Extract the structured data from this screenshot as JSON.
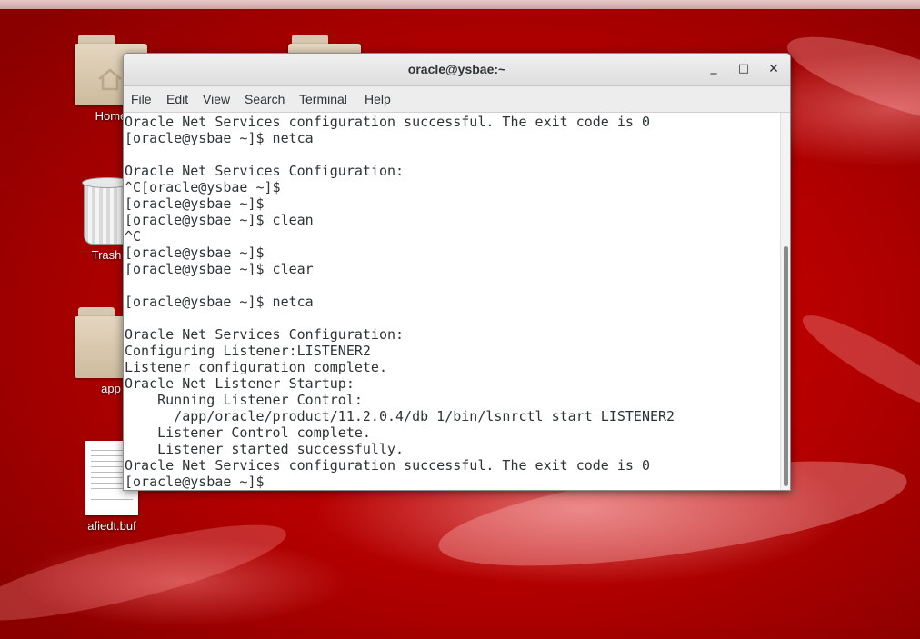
{
  "desktop": {
    "icons": [
      {
        "label": "Home",
        "icon": "home-folder-icon"
      },
      {
        "label": "",
        "icon": "folder-icon"
      },
      {
        "label": "Trash",
        "icon": "trash-icon"
      },
      {
        "label": "app",
        "icon": "folder-icon"
      },
      {
        "label": "afiedt.buf",
        "icon": "text-document-icon"
      }
    ],
    "accent_color": "#cc0000"
  },
  "terminal": {
    "title": "oracle@ysbae:~",
    "controls": {
      "minimize": "_",
      "maximize": "□",
      "close": "✕"
    },
    "menu": [
      "File",
      "Edit",
      "View",
      "Search",
      "Terminal",
      "Help"
    ],
    "lines": [
      "Oracle Net Services configuration successful. The exit code is 0",
      "[oracle@ysbae ~]$ netca",
      "",
      "Oracle Net Services Configuration:",
      "^C[oracle@ysbae ~]$",
      "[oracle@ysbae ~]$",
      "[oracle@ysbae ~]$ clean",
      "^C",
      "[oracle@ysbae ~]$",
      "[oracle@ysbae ~]$ clear",
      "",
      "[oracle@ysbae ~]$ netca",
      "",
      "Oracle Net Services Configuration:",
      "Configuring Listener:LISTENER2",
      "Listener configuration complete.",
      "Oracle Net Listener Startup:",
      "    Running Listener Control:",
      "      /app/oracle/product/11.2.0.4/db_1/bin/lsnrctl start LISTENER2",
      "    Listener Control complete.",
      "    Listener started successfully.",
      "Oracle Net Services configuration successful. The exit code is 0",
      "[oracle@ysbae ~]$"
    ]
  }
}
